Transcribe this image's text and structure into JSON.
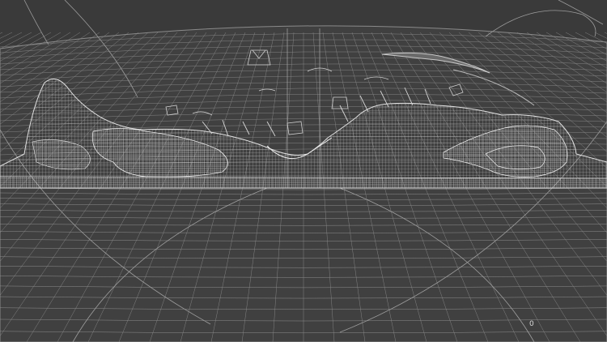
{
  "viewport": {
    "background": "#3a3a3a",
    "wire_color": "#cfcfcf",
    "counter": "0"
  },
  "icons": {
    "scene": "wireframe-terrain-icon"
  }
}
